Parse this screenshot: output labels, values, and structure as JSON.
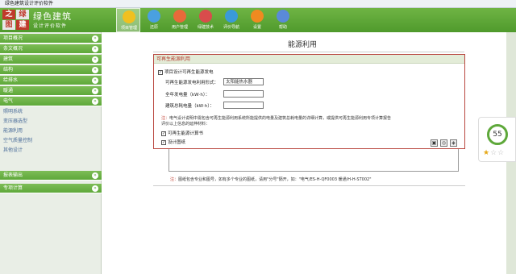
{
  "window": {
    "title": "绿色建筑设计评价软件"
  },
  "logo": {
    "cells": [
      "之",
      "绿",
      "图",
      "建"
    ],
    "title": "绿色建筑",
    "subtitle": "设计评价软件"
  },
  "nav": [
    {
      "label": "项目管理",
      "icon": "project-folder-icon",
      "color": "#f0c020",
      "active": true
    },
    {
      "label": "还原",
      "icon": "restore-icon",
      "color": "#4aa0e0",
      "active": false
    },
    {
      "label": "用户管理",
      "icon": "users-icon",
      "color": "#e86a3a",
      "active": false
    },
    {
      "label": "绿建技术",
      "icon": "tools-icon",
      "color": "#d94c4c",
      "active": false
    },
    {
      "label": "评价导航",
      "icon": "compass-icon",
      "color": "#3a9ad9",
      "active": false
    },
    {
      "label": "设置",
      "icon": "gear-icon",
      "color": "#f08a20",
      "active": false
    },
    {
      "label": "帮助",
      "icon": "help-icon",
      "color": "#5a8ad9",
      "active": false
    }
  ],
  "sidebar": {
    "sections": [
      {
        "label": "项目概况"
      },
      {
        "label": "条文概况"
      },
      {
        "label": "建筑"
      },
      {
        "label": "结构"
      },
      {
        "label": "给排水"
      },
      {
        "label": "暖通"
      },
      {
        "label": "电气"
      }
    ],
    "subitems": [
      "照明系统",
      "变压器选型",
      "能源利用",
      "空气质量控制",
      "其他设计"
    ],
    "bottom_sections": [
      {
        "label": "报表输出"
      },
      {
        "label": "专项计算"
      }
    ]
  },
  "main": {
    "title": "能源利用",
    "panel": {
      "header": "可再生能源利用",
      "checkbox_main": "项目设计可再生能源发电",
      "field_form_label": "可再生能源发电利用形式：",
      "field_form_value": "太阳能热水器",
      "field_annual_label": "全年发电量（kW·h）：",
      "field_annual_value": "",
      "field_building_label": "建筑总耗电量（kW·h）：",
      "field_building_value": "",
      "note_prefix": "注：",
      "note_text": "电气设计说明中需包含可再生能源利用系统所能提供的电量及建筑总耗电量的详细计算，或提供可再生能源利用专项计算报告",
      "note_text2": "评价以上信息的延伸材料：",
      "check_calc": "可再生能源计算书",
      "check_drawings": "设计图纸"
    },
    "bottom_note_prefix": "注：",
    "bottom_note": "图纸包含专业和图号，如有多个专业的图纸，请用\"分号\"隔开，如：\"电气/ES-H-QF0003 暖通/H-H-ST002\""
  },
  "widget": {
    "score": "55",
    "stars_on": 1,
    "stars_total": 3
  }
}
